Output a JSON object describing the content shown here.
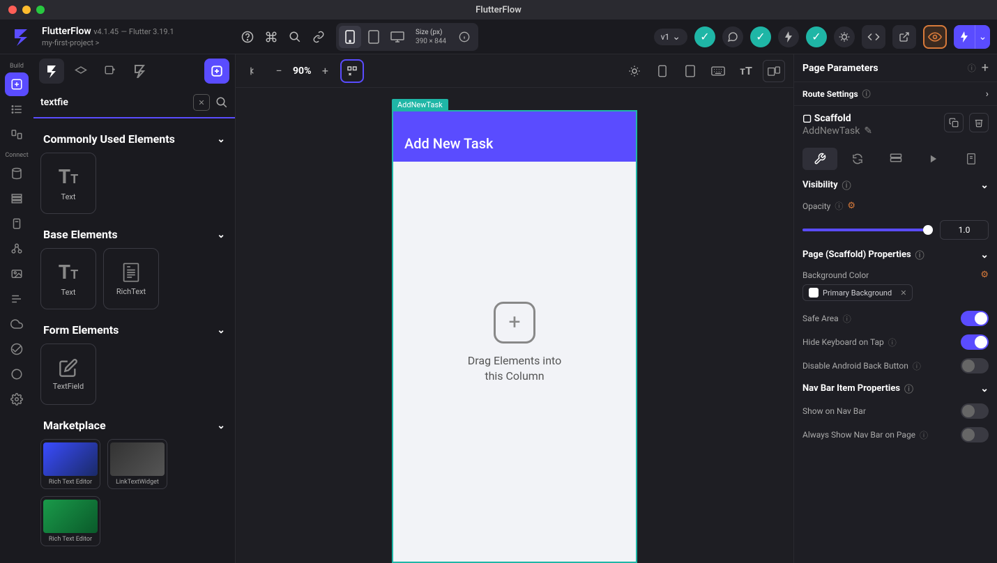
{
  "app_title": "FlutterFlow",
  "header": {
    "brand": "FlutterFlow",
    "version": "v4.1.45",
    "flutter_version": "— Flutter 3.19.1",
    "project_crumb": "my-first-project >",
    "size_label": "Size (px)",
    "size_value": "390 × 844",
    "version_pill": "v1"
  },
  "leftrail": {
    "build_label": "Build",
    "connect_label": "Connect"
  },
  "search": {
    "value": "textfie"
  },
  "widget_panel": {
    "section1_title": "Commonly Used Elements",
    "section1_tiles": [
      {
        "label": "Text",
        "icon": "Tᴛ"
      }
    ],
    "section2_title": "Base Elements",
    "section2_tiles": [
      {
        "label": "Text",
        "icon": "Tᴛ"
      },
      {
        "label": "RichText",
        "icon": "≣"
      }
    ],
    "section3_title": "Form Elements",
    "section3_tiles": [
      {
        "label": "TextField",
        "icon": "✎"
      }
    ],
    "section4_title": "Marketplace",
    "market_tiles": [
      {
        "label": "Rich Text Editor"
      },
      {
        "label": "LinkTextWidget"
      },
      {
        "label": "Rich Text Editor"
      }
    ]
  },
  "canvas": {
    "zoom": "90%",
    "frame_tag": "AddNewTask",
    "appbar_title": "Add New Task",
    "drop_line1": "Drag Elements into",
    "drop_line2": "this Column"
  },
  "props": {
    "page_params_title": "Page Parameters",
    "route_settings_title": "Route Settings",
    "widget_type": "Scaffold",
    "page_name": "AddNewTask",
    "visibility_title": "Visibility",
    "opacity_label": "Opacity",
    "opacity_value": "1.0",
    "page_props_title": "Page (Scaffold) Properties",
    "bg_color_label": "Background Color",
    "bg_chip_label": "Primary Background",
    "safe_area_label": "Safe Area",
    "hide_kb_label": "Hide Keyboard on Tap",
    "disable_back_label": "Disable Android Back Button",
    "navbar_title": "Nav Bar Item Properties",
    "show_nav_label": "Show on Nav Bar",
    "always_nav_label": "Always Show Nav Bar on Page"
  }
}
